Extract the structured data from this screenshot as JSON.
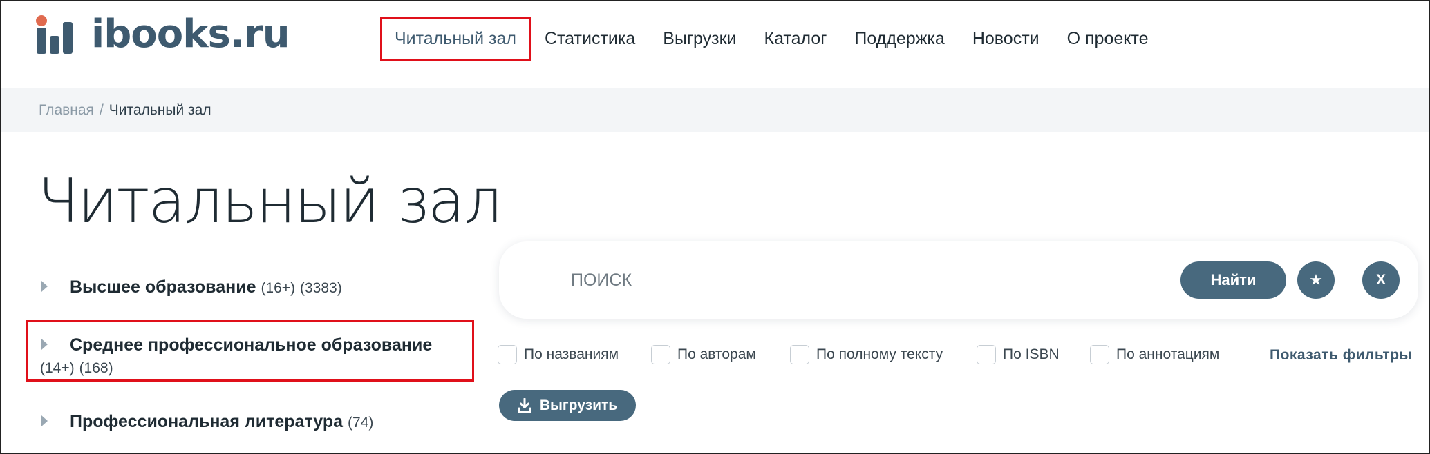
{
  "brand": {
    "logo_text": "ibooks.ru",
    "accent_color": "#3e5a6f",
    "dot_color": "#e06a4f"
  },
  "nav": {
    "items": [
      {
        "label": "Читальный зал",
        "active": true
      },
      {
        "label": "Статистика"
      },
      {
        "label": "Выгрузки"
      },
      {
        "label": "Каталог"
      },
      {
        "label": "Поддержка"
      },
      {
        "label": "Новости"
      },
      {
        "label": "О проекте"
      }
    ]
  },
  "breadcrumb": {
    "home": "Главная",
    "separator": "/",
    "current": "Читальный зал"
  },
  "page": {
    "title": "Читальный зал"
  },
  "categories": [
    {
      "name": "Высшее образование",
      "age": "(16+)",
      "count": "(3383)"
    },
    {
      "name": "Среднее профессиональное образование",
      "age": "(14+)",
      "count": "(168)"
    },
    {
      "name": "Профессиональная литература",
      "age": "",
      "count": "(74)"
    }
  ],
  "search": {
    "placeholder": "ПОИСК",
    "value": "",
    "find_label": "Найти",
    "star_icon": "star-icon",
    "close_label": "X"
  },
  "filters": [
    {
      "label": "По названиям",
      "checked": false
    },
    {
      "label": "По авторам",
      "checked": false
    },
    {
      "label": "По полному тексту",
      "checked": false
    },
    {
      "label": "По ISBN",
      "checked": false
    },
    {
      "label": "По аннотациям",
      "checked": false
    }
  ],
  "show_filters_label": "Показать фильтры",
  "export_label": "Выгрузить",
  "button_color": "#48697e"
}
